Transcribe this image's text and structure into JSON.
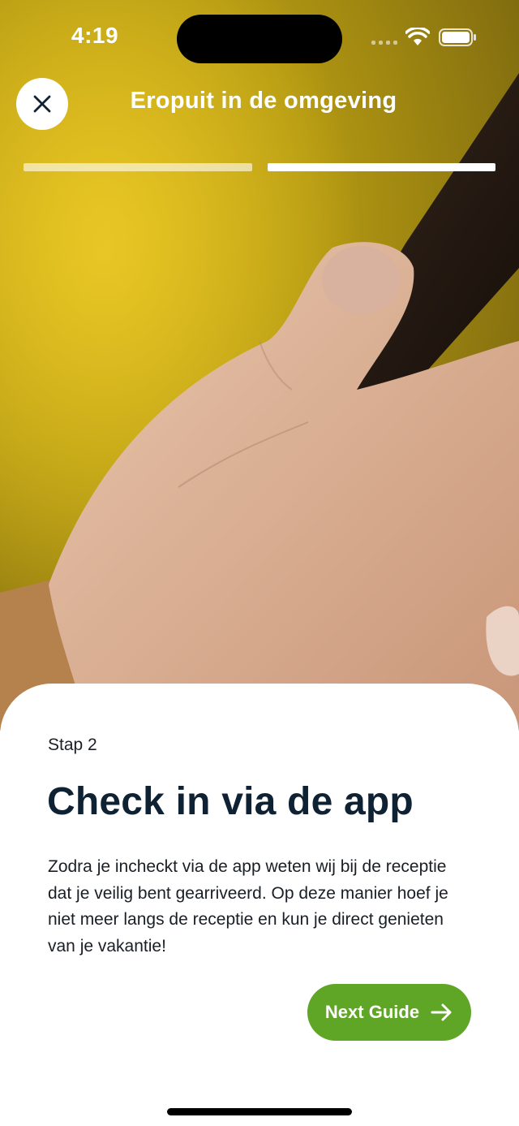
{
  "status_bar": {
    "time": "4:19"
  },
  "header": {
    "title": "Eropuit in de omgeving",
    "close_icon": "close-icon"
  },
  "progress": {
    "total_steps": 2,
    "current_step": 2
  },
  "card": {
    "step_label": "Stap 2",
    "title": "Check in via de app",
    "body": "Zodra je incheckt via de app weten wij bij de receptie dat je veilig bent gearriveerd. Op deze manier hoef je niet meer langs de receptie en kun je direct genieten van je vakantie!",
    "next_button_label": "Next Guide",
    "next_button_icon": "arrow-right-icon"
  },
  "colors": {
    "accent": "#5fa526",
    "title_text": "#0f2233"
  }
}
